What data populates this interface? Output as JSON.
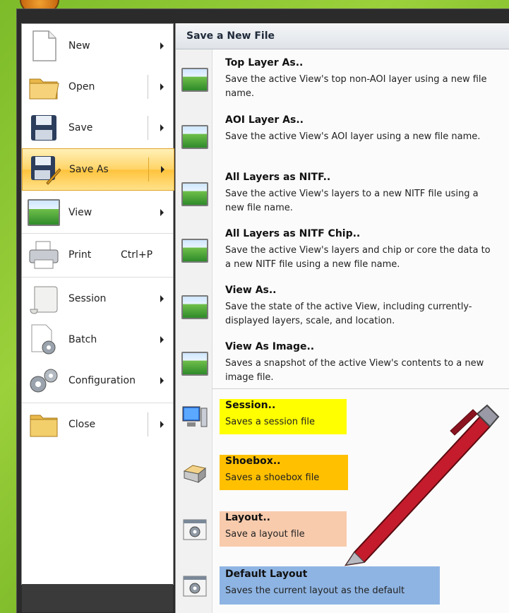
{
  "left_menu": {
    "items": [
      {
        "label": "New",
        "shortcut": "",
        "has_arrow": true,
        "icon": "new-file-icon"
      },
      {
        "label": "Open",
        "shortcut": "",
        "has_arrow": true,
        "icon": "folder-icon"
      },
      {
        "label": "Save",
        "shortcut": "",
        "has_arrow": true,
        "icon": "floppy-disk-icon"
      },
      {
        "label": "Save As",
        "shortcut": "",
        "has_arrow": true,
        "icon": "save-as-icon",
        "active": true
      },
      {
        "label": "View",
        "shortcut": "",
        "has_arrow": true,
        "icon": "landscape-image-icon"
      },
      {
        "label": "Print",
        "shortcut": "Ctrl+P",
        "has_arrow": false,
        "icon": "printer-icon"
      },
      {
        "label": "Session",
        "shortcut": "",
        "has_arrow": true,
        "icon": "scroll-icon"
      },
      {
        "label": "Batch",
        "shortcut": "",
        "has_arrow": true,
        "icon": "batch-gear-icon"
      },
      {
        "label": "Configuration",
        "shortcut": "",
        "has_arrow": true,
        "icon": "gears-icon"
      },
      {
        "label": "Close",
        "shortcut": "",
        "has_arrow": true,
        "icon": "folder-icon"
      }
    ]
  },
  "submenu": {
    "header": "Save a New File",
    "items": [
      {
        "title": "Top Layer As..",
        "description": "Save the active View's top non-AOI layer using a new file name.",
        "icon": "landscape-image-icon"
      },
      {
        "title": "AOI Layer As..",
        "description": "Save the active View's AOI layer using a new file name.",
        "icon": "landscape-image-icon"
      },
      {
        "title": "All Layers as NITF..",
        "description": "Save the active View's layers to a new NITF file using a new file name.",
        "icon": "landscape-image-icon"
      },
      {
        "title": "All Layers as NITF Chip..",
        "description": "Save the active View's layers and chip or core the data to a new NITF file using a new file name.",
        "icon": "landscape-image-icon"
      },
      {
        "title": "View As..",
        "description": "Save the state of the active View, including currently-displayed layers, scale, and location.",
        "icon": "landscape-image-icon"
      },
      {
        "title": "View As Image..",
        "description": "Saves a snapshot of the active View's contents to a new image file.",
        "icon": "landscape-image-icon"
      },
      {
        "title": "Session..",
        "description": "Saves a session file",
        "icon": "computer-icon",
        "highlight": "#ffff00"
      },
      {
        "title": "Shoebox..",
        "description": "Saves a shoebox file",
        "icon": "shoebox-icon",
        "highlight": "#ffc000"
      },
      {
        "title": "Layout..",
        "description": "Save a layout file",
        "icon": "layout-gear-icon",
        "highlight": "#f8cbad"
      },
      {
        "title": "Default Layout",
        "description": "Saves the current layout as the default",
        "icon": "layout-gear-icon",
        "highlight": "#8eb4e3"
      }
    ]
  },
  "colors": {
    "active_item": "#ffd466",
    "session_highlight": "#ffff00",
    "shoebox_highlight": "#ffc000",
    "layout_highlight": "#f8cbad",
    "default_layout_highlight": "#8eb4e3"
  }
}
